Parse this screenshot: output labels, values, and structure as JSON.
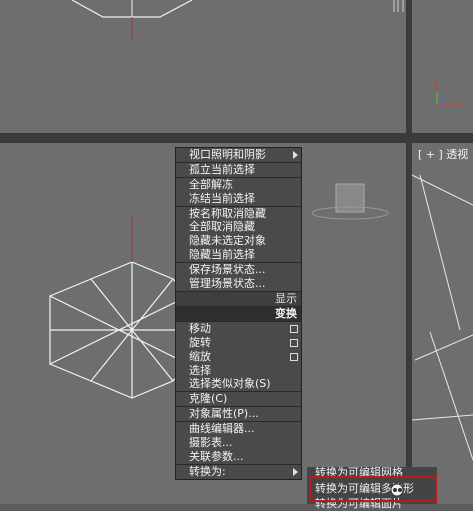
{
  "viewport": {
    "persp_label": "[ + ] 透视"
  },
  "quad_menu": {
    "group1": [
      {
        "label": "视口照明和阴影",
        "submenu": true
      },
      {
        "label": "孤立当前选择"
      },
      {
        "label": "全部解冻"
      },
      {
        "label": "冻结当前选择"
      },
      {
        "label": "按名称取消隐藏"
      },
      {
        "label": "全部取消隐藏"
      },
      {
        "label": "隐藏未选定对象"
      },
      {
        "label": "隐藏当前选择"
      },
      {
        "label": "保存场景状态..."
      },
      {
        "label": "管理场景状态..."
      }
    ],
    "header_display": "显示",
    "header_transform": "变换",
    "group2": [
      {
        "label": "移动",
        "box": true
      },
      {
        "label": "旋转",
        "box": true
      },
      {
        "label": "缩放",
        "box": true
      },
      {
        "label": "选择"
      },
      {
        "label": "选择类似对象(S)"
      },
      {
        "label": "克隆(C)"
      },
      {
        "label": "对象属性(P)..."
      },
      {
        "label": "曲线编辑器..."
      },
      {
        "label": "摄影表..."
      },
      {
        "label": "关联参数..."
      },
      {
        "label": "转换为:",
        "submenu": true
      }
    ]
  },
  "submenu": {
    "item1": "转换为可编辑网格",
    "item2": "转换为可编辑多边形",
    "item3": "转换为可编辑面片"
  },
  "colors": {
    "highlight_border": "#c01818",
    "menu_bg": "#4a4a4a",
    "viewport_bg": "#6e6e6e"
  }
}
